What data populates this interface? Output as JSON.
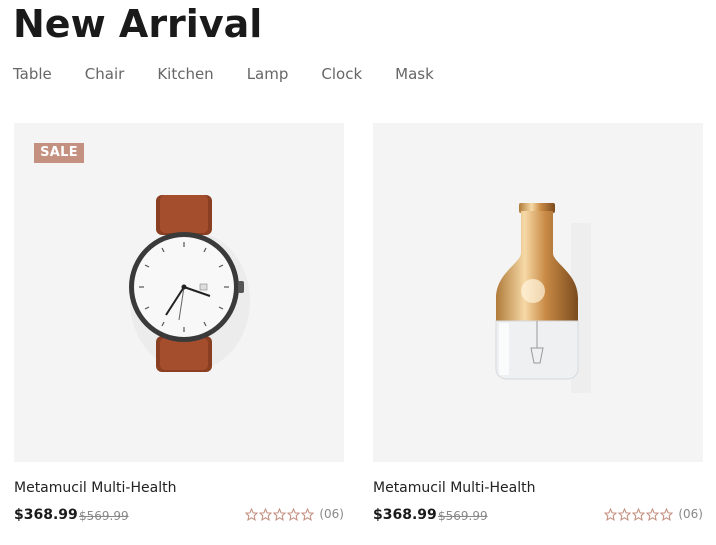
{
  "header": {
    "title": "New Arrival"
  },
  "tabs": [
    {
      "label": "Table"
    },
    {
      "label": "Chair"
    },
    {
      "label": "Kitchen"
    },
    {
      "label": "Lamp"
    },
    {
      "label": "Clock"
    },
    {
      "label": "Mask"
    }
  ],
  "products": [
    {
      "badge": "SALE",
      "name": "Metamucil Multi-Health",
      "price": "$368.99",
      "old_price": "$569.99",
      "rating": 0,
      "rating_max": 5,
      "review_count": "(06)",
      "image_icon": "wristwatch-icon"
    },
    {
      "badge": "",
      "name": "Metamucil Multi-Health",
      "price": "$368.99",
      "old_price": "$569.99",
      "rating": 0,
      "rating_max": 5,
      "review_count": "(06)",
      "image_icon": "bulb-lamp-icon"
    }
  ],
  "colors": {
    "badge_bg": "#c49180",
    "star_outline": "#c49180",
    "image_bg": "#f4f4f4"
  }
}
